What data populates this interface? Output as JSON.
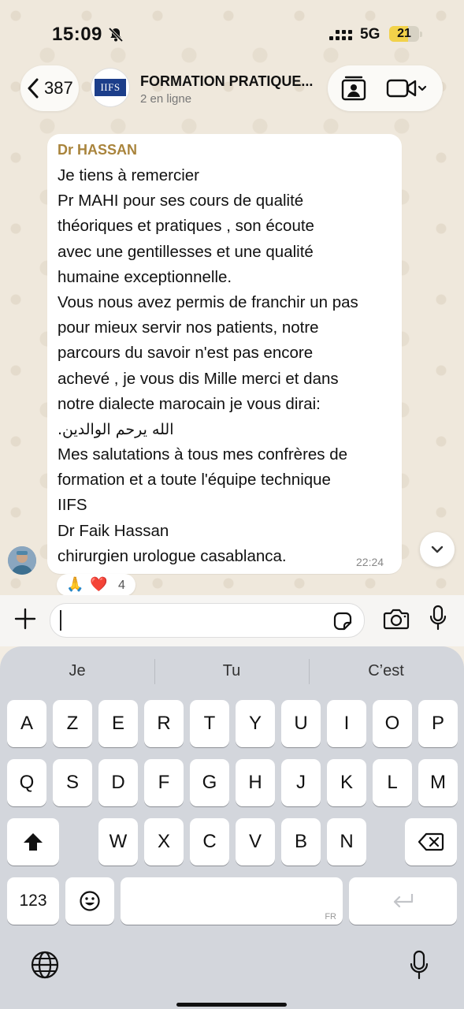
{
  "status_bar": {
    "time": "15:09",
    "network": "5G",
    "battery_level": "21",
    "icons": [
      "bell-off-icon",
      "signal-icon",
      "battery-icon"
    ]
  },
  "header": {
    "back_count": "387",
    "group_logo": "IIFS",
    "group_title": "FORMATION PRATIQUE...",
    "online_status": "2 en ligne",
    "icons": [
      "chevron-left-icon",
      "contact-card-icon",
      "video-camera-icon",
      "chevron-down-icon"
    ]
  },
  "message": {
    "sender": "Dr HASSAN",
    "sender_color": "#a9843c",
    "lines": [
      "Je tiens à remercier",
      "Pr MAHI  pour ses cours de qualité",
      "théoriques et pratiques , son écoute",
      "avec une gentillesses et une qualité",
      "humaine  exceptionnelle.",
      "Vous nous avez permis de franchir un pas",
      "pour mieux servir nos patients, notre",
      "parcours du savoir  n'est pas encore",
      "achevé   , je vous  dis Mille merci et dans",
      "notre dialecte  marocain je vous dirai:",
      "الله يرحم الوالدين.",
      "Mes salutations à tous mes confrères de",
      "formation et a toute l'équipe technique",
      "IIFS",
      "Dr Faik Hassan",
      "chirurgien urologue casablanca."
    ],
    "time": "22:24",
    "reactions": {
      "emojis": [
        "🙏",
        "❤️"
      ],
      "count": "4"
    }
  },
  "composer": {
    "placeholder": "",
    "icons": [
      "plus-icon",
      "sticker-icon",
      "camera-icon",
      "microphone-icon"
    ]
  },
  "keyboard": {
    "suggestions": [
      "Je",
      "Tu",
      "C’est"
    ],
    "row1": [
      "A",
      "Z",
      "E",
      "R",
      "T",
      "Y",
      "U",
      "I",
      "O",
      "P"
    ],
    "row2": [
      "Q",
      "S",
      "D",
      "F",
      "G",
      "H",
      "J",
      "K",
      "L",
      "M"
    ],
    "row3": [
      "W",
      "X",
      "C",
      "V",
      "B",
      "N"
    ],
    "numbers_label": "123",
    "space_lang": "FR",
    "icons": [
      "shift-icon",
      "backspace-icon",
      "emoji-icon",
      "return-icon",
      "globe-icon",
      "dictation-icon"
    ]
  }
}
